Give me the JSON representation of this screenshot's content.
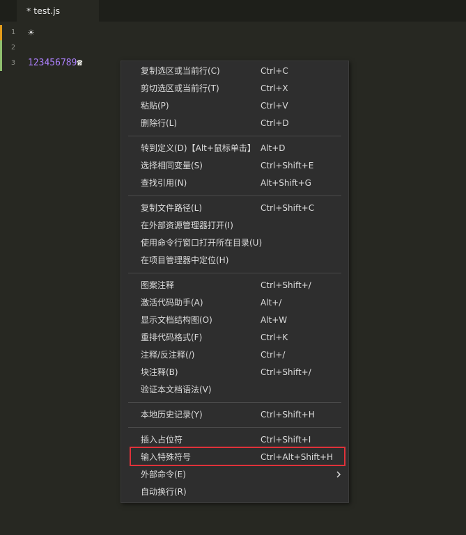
{
  "tab": {
    "title": "* test.js"
  },
  "editor": {
    "lines": [
      {
        "num": "1",
        "text": "☀"
      },
      {
        "num": "2",
        "text": ""
      },
      {
        "num": "3",
        "number": "123456789",
        "symbol": "☎"
      }
    ],
    "gutter_colors": {
      "modified": "#e39c1b",
      "added": "#8fbf6e"
    }
  },
  "context_menu": {
    "highlight_color": "#e0323a",
    "items": [
      {
        "label": "复制选区或当前行(C)",
        "shortcut": "Ctrl+C"
      },
      {
        "label": "剪切选区或当前行(T)",
        "shortcut": "Ctrl+X"
      },
      {
        "label": "粘贴(P)",
        "shortcut": "Ctrl+V"
      },
      {
        "label": "删除行(L)",
        "shortcut": "Ctrl+D"
      },
      {
        "label": "转到定义(D)【Alt+鼠标单击】",
        "shortcut": "Alt+D"
      },
      {
        "label": "选择相同变量(S)",
        "shortcut": "Ctrl+Shift+E"
      },
      {
        "label": "查找引用(N)",
        "shortcut": "Alt+Shift+G"
      },
      {
        "label": "复制文件路径(L)",
        "shortcut": "Ctrl+Shift+C"
      },
      {
        "label": "在外部资源管理器打开(I)",
        "shortcut": ""
      },
      {
        "label": "使用命令行窗口打开所在目录(U)",
        "shortcut": ""
      },
      {
        "label": "在项目管理器中定位(H)",
        "shortcut": ""
      },
      {
        "label": "图案注释",
        "shortcut": "Ctrl+Shift+/"
      },
      {
        "label": "激活代码助手(A)",
        "shortcut": "Alt+/"
      },
      {
        "label": "显示文档结构图(O)",
        "shortcut": "Alt+W"
      },
      {
        "label": "重排代码格式(F)",
        "shortcut": "Ctrl+K"
      },
      {
        "label": "注释/反注释(/)",
        "shortcut": "Ctrl+/"
      },
      {
        "label": "块注释(B)",
        "shortcut": "Ctrl+Shift+/"
      },
      {
        "label": "验证本文档语法(V)",
        "shortcut": ""
      },
      {
        "label": "本地历史记录(Y)",
        "shortcut": "Ctrl+Shift+H"
      },
      {
        "label": "插入占位符",
        "shortcut": "Ctrl+Shift+I"
      },
      {
        "label": "输入特殊符号",
        "shortcut": "Ctrl+Alt+Shift+H"
      },
      {
        "label": "外部命令(E)",
        "shortcut": "",
        "submenu_icon": "chevron-right-icon"
      },
      {
        "label": "自动换行(R)",
        "shortcut": ""
      }
    ]
  }
}
